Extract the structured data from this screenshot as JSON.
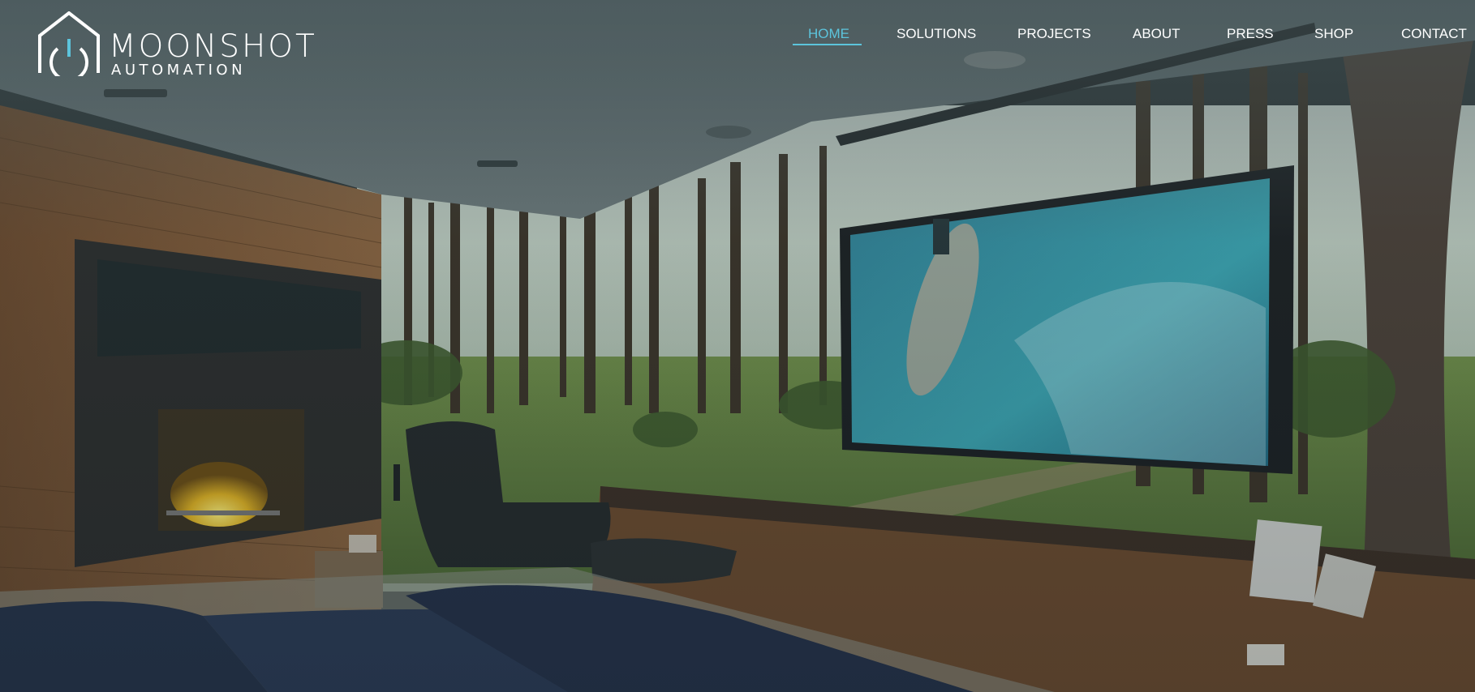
{
  "brand": {
    "name": "MOONSHOT",
    "tagline": "AUTOMATION",
    "accent_color": "#5cc4dc",
    "logo_icon": "house-power-icon"
  },
  "nav": {
    "active": "HOME",
    "items": [
      {
        "label": "HOME"
      },
      {
        "label": "SOLUTIONS"
      },
      {
        "label": "PROJECTS"
      },
      {
        "label": "ABOUT"
      },
      {
        "label": "PRESS"
      },
      {
        "label": "SHOP"
      },
      {
        "label": "CONTACT"
      }
    ]
  },
  "hero": {
    "image": "bedroom-home-cinema-forest-view"
  }
}
